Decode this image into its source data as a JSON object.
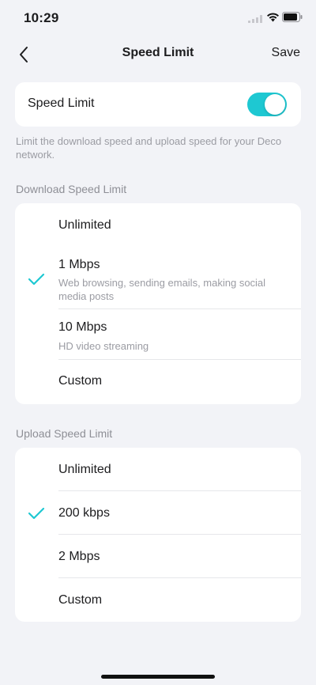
{
  "status_bar": {
    "time": "10:29"
  },
  "nav": {
    "title": "Speed Limit",
    "save_label": "Save"
  },
  "speed_limit": {
    "label": "Speed Limit",
    "enabled": true
  },
  "description": "Limit the download speed and upload speed for your Deco network.",
  "download": {
    "title": "Download Speed Limit",
    "options": [
      {
        "label": "Unlimited",
        "sub": "",
        "selected": false
      },
      {
        "label": "1 Mbps",
        "sub": "Web browsing, sending emails, making social media posts",
        "selected": true
      },
      {
        "label": "10 Mbps",
        "sub": "HD video streaming",
        "selected": false
      },
      {
        "label": "Custom",
        "sub": "",
        "selected": false
      }
    ]
  },
  "upload": {
    "title": "Upload Speed Limit",
    "options": [
      {
        "label": "Unlimited",
        "selected": false
      },
      {
        "label": "200 kbps",
        "selected": true
      },
      {
        "label": "2 Mbps",
        "selected": false
      },
      {
        "label": "Custom",
        "selected": false
      }
    ]
  },
  "colors": {
    "accent": "#1ec8d2",
    "background": "#f2f3f7",
    "card": "#ffffff"
  }
}
